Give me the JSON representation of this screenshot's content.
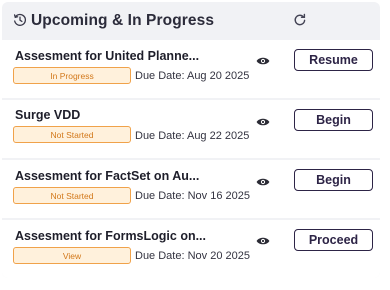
{
  "header": {
    "title": "Upcoming & In Progress",
    "title_icon": "clock-history-icon",
    "refresh_icon": "refresh-icon"
  },
  "items": [
    {
      "name": "Assesment for United Planne...",
      "status": "In Progress",
      "due": "Due Date: Aug 20 2025",
      "action": "Resume"
    },
    {
      "name": "Surge VDD",
      "status": "Not Started",
      "due": "Due Date: Aug 22 2025",
      "action": "Begin"
    },
    {
      "name": "Assesment for FactSet on Au...",
      "status": "Not Started",
      "due": "Due Date: Nov 16 2025",
      "action": "Begin"
    },
    {
      "name": "Assesment for FormsLogic on...",
      "status": "View",
      "due": "Due Date: Nov 20 2025",
      "action": "Proceed"
    }
  ],
  "colors": {
    "panel_bg": "#f1f2f5",
    "status_border": "#f0a24a",
    "status_bg": "#fff1dc",
    "status_text": "#d2781a",
    "button_border": "#2d2446"
  }
}
